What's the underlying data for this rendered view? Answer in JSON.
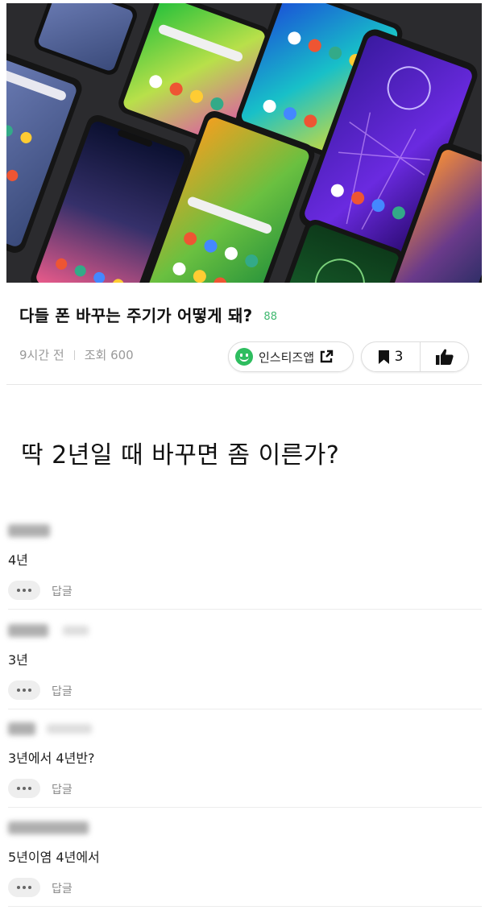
{
  "post": {
    "title": "다들 폰 바꾸는 주기가 어떻게 돼?",
    "comment_count": "88",
    "time_ago": "9시간 전",
    "views": "조회 600",
    "body": "딱 2년일 때 바꾸면 좀 이른가?"
  },
  "actions": {
    "app_label": "인스티즈앱",
    "bookmark_count": "3"
  },
  "comments": [
    {
      "text": "4년",
      "reply_label": "답글"
    },
    {
      "text": "3년",
      "reply_label": "답글"
    },
    {
      "text": "3년에서 4년반?",
      "reply_label": "답글"
    },
    {
      "text": "5년이염 4년에서",
      "reply_label": "답글"
    }
  ],
  "colors": {
    "accent_green": "#2ebd5f",
    "count_green": "#3fb86f"
  },
  "icons": [
    "smile-icon",
    "external-link-icon",
    "bookmark-icon",
    "thumbs-up-icon",
    "more-dots-icon"
  ]
}
